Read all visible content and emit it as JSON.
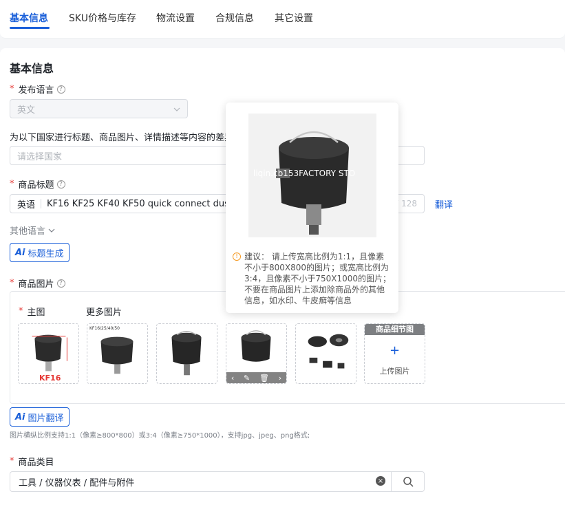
{
  "tabs": [
    {
      "label": "基本信息"
    },
    {
      "label": "SKU价格与库存"
    },
    {
      "label": "物流设置"
    },
    {
      "label": "合规信息"
    },
    {
      "label": "其它设置"
    }
  ],
  "section_title": "基本信息",
  "language": {
    "label": "发布语言",
    "value": "英文"
  },
  "country_diff": {
    "label": "为以下国家进行标题、商品图片、详情描述等内容的差异",
    "placeholder": "请选择国家"
  },
  "title_field": {
    "label": "商品标题",
    "lang": "英语",
    "value": "KF16  KF25  KF40  KF50 quick connect dust filte",
    "counter": "/ 128",
    "translate": "翻译"
  },
  "other_lang": "其他语言",
  "ai_title_btn": "标题生成",
  "ai_mark": "Ai",
  "images": {
    "label": "商品图片",
    "main_label": "主图",
    "more_label": "更多图片",
    "detail_head": "商品细节图",
    "upload_plus": "+",
    "upload_label": "上传图片",
    "thumb_kf16": "KF16",
    "thumb_kf_tag": "KF16/25/40/50",
    "watermark": "liqincb153FACTORY STO",
    "ai_translate_btn": "图片翻译",
    "hint": "图片横纵比例支持1:1（像素≥800*800）或3:4（像素≥750*1000），支持jpg、jpeg、png格式;"
  },
  "popover": {
    "watermark": "liqin.cb153FACTORY STO",
    "tip": "建议：  请上传宽高比例为1:1，且像素不小于800X800的图片；或宽高比例为3:4，且像素不小于750X1000的图片；不要在商品图片上添加除商品外的其他信息，如水印、牛皮癣等信息",
    "tip_icon": "!"
  },
  "category": {
    "label": "商品类目",
    "value": "工具 / 仪器仪表 / 配件与附件",
    "clear_icon": "×"
  },
  "colors": {
    "accent": "#1a5fd9",
    "required": "#e53935"
  }
}
